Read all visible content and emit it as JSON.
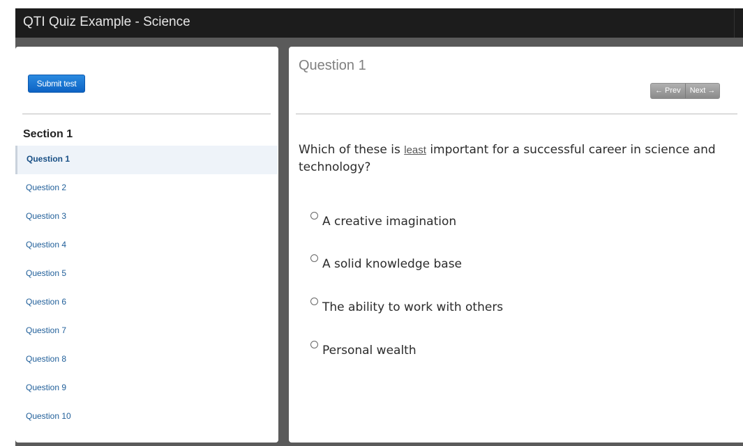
{
  "window": {
    "title": "QTI Quiz Example - Science"
  },
  "sidebar": {
    "submit_label": "Submit test",
    "section_title": "Section 1",
    "questions": [
      "Question 1",
      "Question 2",
      "Question 3",
      "Question 4",
      "Question 5",
      "Question 6",
      "Question 7",
      "Question 8",
      "Question 9",
      "Question 10"
    ],
    "active_index": 0
  },
  "main": {
    "heading": "Question 1",
    "prev_label": "← Prev",
    "next_label": "Next →",
    "prompt_before": "Which of these is ",
    "prompt_emphasis": "least",
    "prompt_after": " important for a successful career in science and technology?",
    "choices": [
      "A creative imagination",
      "A solid knowledge base",
      "The ability to work with others",
      "Personal wealth"
    ]
  },
  "colors": {
    "accent": "#0d63c4",
    "link": "#1f5e99",
    "titlebar": "#1c1c1c",
    "backdrop": "#5a5a5a"
  },
  "icons": {
    "prev": "arrow-left-icon",
    "next": "arrow-right-icon",
    "choice": "radio-icon"
  }
}
